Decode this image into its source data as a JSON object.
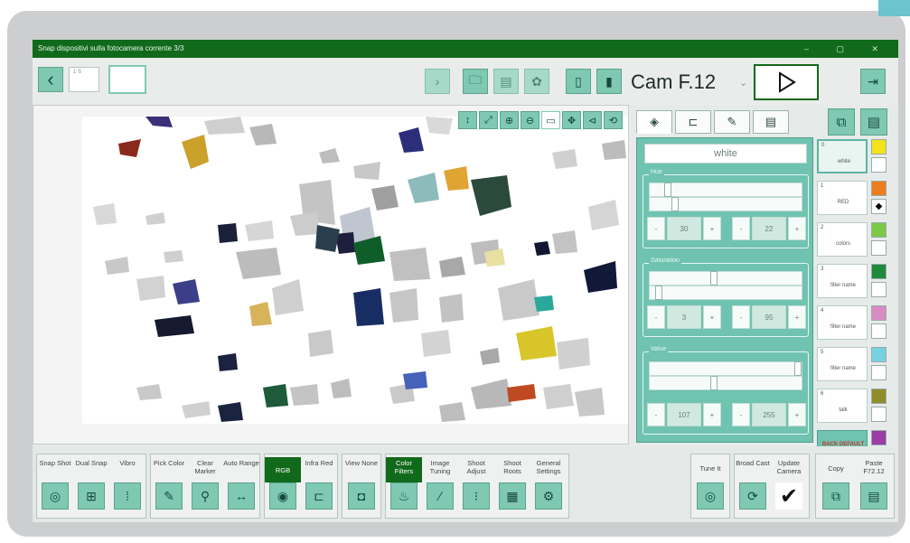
{
  "window": {
    "title": "Snap dispositivi sulla fotocamera corrente 3/3",
    "controls": "– ▢ ✕"
  },
  "toolbar": {
    "back_icon": "‹",
    "thumb1_label": "1 S",
    "camera_label": "Cam F.12",
    "camera_dropdown": "⌄"
  },
  "icons": {
    "folder": "🗀",
    "save": "▤",
    "palette": "✿",
    "doc_a": "▯",
    "doc_b": "▮",
    "play": "▷",
    "exit": "⇥",
    "copy": "⧉",
    "clipboard": "▤",
    "camera": "◎",
    "eyedropper": "✎",
    "marker": "⚲",
    "range": "↔",
    "rgb": "◉",
    "ir": "⊏",
    "view": "◘",
    "filter": "♨",
    "tuning": "∕",
    "adjust": "⁝",
    "roots": "▦",
    "settings": "⚙",
    "check": "✔",
    "broadcast": "⟳"
  },
  "image_tools": [
    "↕",
    "⤢",
    "⊕",
    "⊖",
    "▭",
    "✥",
    "⊲",
    "⟲"
  ],
  "side": {
    "tabs": [
      {
        "icon": "◈"
      },
      {
        "icon": "⊏"
      },
      {
        "icon": "✎"
      },
      {
        "icon": "▤"
      }
    ],
    "filter_name": "white",
    "hue": {
      "label": "Hue",
      "min": "30",
      "max": "22",
      "min_level": 0.1,
      "max_level": 0.15
    },
    "saturation": {
      "label": "Saturation",
      "min": "3",
      "max": "95",
      "min_level": 0.04,
      "max_level": 0.42
    },
    "value": {
      "label": "Value",
      "min": "107",
      "max": "255",
      "min_level": 0.42,
      "max_level": 1.0
    },
    "minus": "-",
    "plus": "+",
    "presets": [
      {
        "num": "0",
        "name": "white",
        "color": "#f4e21a",
        "check": ""
      },
      {
        "num": "1",
        "name": "RED",
        "color": "#ef7d1d",
        "check": "◆"
      },
      {
        "num": "2",
        "name": "colors",
        "color": "#7bc944",
        "check": ""
      },
      {
        "num": "3",
        "name": "filter name",
        "color": "#1f8a3c",
        "check": ""
      },
      {
        "num": "4",
        "name": "filter name",
        "color": "#d98bc4",
        "check": ""
      },
      {
        "num": "5",
        "name": "filter name",
        "color": "#76d1e0",
        "check": ""
      },
      {
        "num": "6",
        "name": "talk",
        "color": "#8f8c2a",
        "check": ""
      },
      {
        "num": "",
        "name": "BACK DEFAULT",
        "color": "#9a3ca4",
        "check": ""
      }
    ]
  },
  "bottom": {
    "groups": [
      {
        "buttons": [
          {
            "label": "Snap Shot",
            "icon": "◎"
          },
          {
            "label": "Dual Snap",
            "icon": "⊞"
          },
          {
            "label": "Vibro",
            "icon": "⁞"
          }
        ]
      },
      {
        "buttons": [
          {
            "label": "Pick Color",
            "icon": "✎"
          },
          {
            "label": "Clear Marker",
            "icon": "⚲"
          },
          {
            "label": "Auto Range",
            "icon": "↔"
          }
        ]
      },
      {
        "buttons": [
          {
            "label": "RGB",
            "icon": "◉"
          },
          {
            "label": "Infra Red",
            "icon": "⊏"
          }
        ]
      },
      {
        "buttons": [
          {
            "label": "View None",
            "icon": "◘"
          }
        ]
      },
      {
        "buttons": [
          {
            "label": "Color Filters",
            "icon": "♨"
          },
          {
            "label": "Image Tuning",
            "icon": "∕"
          },
          {
            "label": "Shoot Adjust",
            "icon": "⁝"
          },
          {
            "label": "Shoot Roots",
            "icon": "▦"
          },
          {
            "label": "General Settings",
            "icon": "⚙"
          }
        ]
      },
      {
        "buttons": [
          {
            "label": "Tune It",
            "icon": "◎"
          }
        ]
      },
      {
        "buttons": [
          {
            "label": "Broad Cast",
            "icon": "⟳"
          },
          {
            "label": "Update Camera",
            "icon": "✔"
          }
        ]
      },
      {
        "buttons": [
          {
            "label": "Copy",
            "icon": "⧉"
          },
          {
            "label": "Paste F72.12",
            "icon": "▤"
          }
        ]
      }
    ]
  }
}
